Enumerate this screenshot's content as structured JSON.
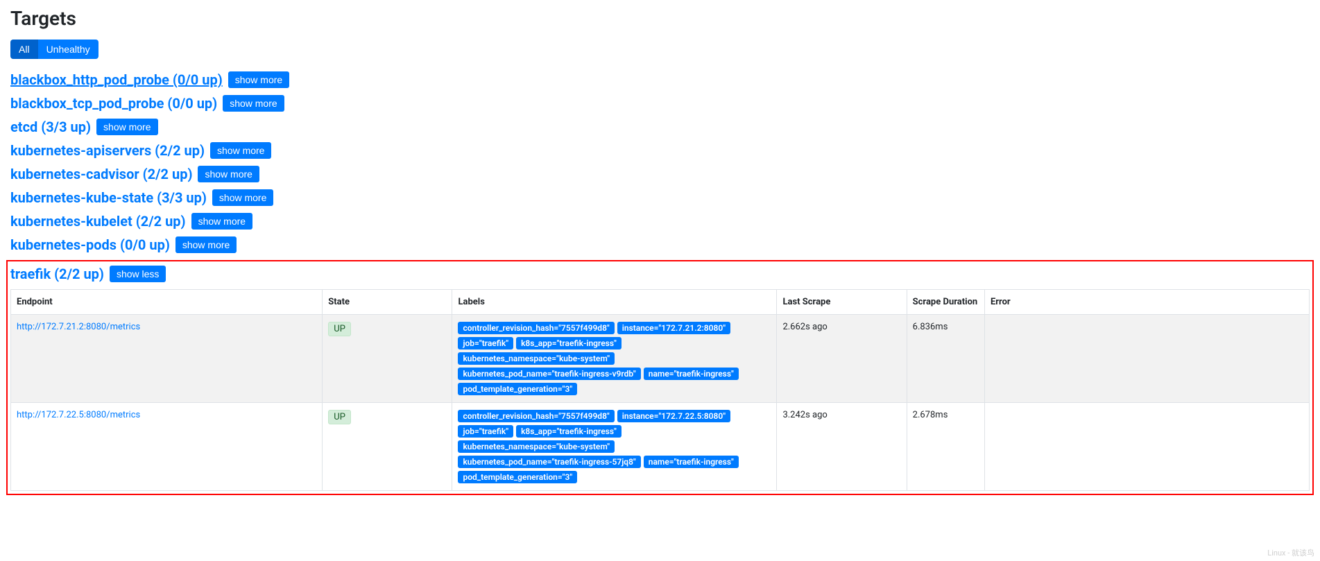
{
  "title": "Targets",
  "filter": {
    "all": "All",
    "unhealthy": "Unhealthy"
  },
  "show_more": "show more",
  "show_less": "show less",
  "targets": [
    {
      "name": "blackbox_http_pod_probe (0/0 up)",
      "underlined": true
    },
    {
      "name": "blackbox_tcp_pod_probe (0/0 up)"
    },
    {
      "name": "etcd (3/3 up)"
    },
    {
      "name": "kubernetes-apiservers (2/2 up)"
    },
    {
      "name": "kubernetes-cadvisor (2/2 up)"
    },
    {
      "name": "kubernetes-kube-state (3/3 up)"
    },
    {
      "name": "kubernetes-kubelet (2/2 up)"
    },
    {
      "name": "kubernetes-pods (0/0 up)"
    }
  ],
  "expanded": {
    "name": "traefik (2/2 up)",
    "columns": {
      "endpoint": "Endpoint",
      "state": "State",
      "labels": "Labels",
      "last_scrape": "Last Scrape",
      "scrape_duration": "Scrape Duration",
      "error": "Error"
    },
    "rows": [
      {
        "endpoint": "http://172.7.21.2:8080/metrics",
        "state": "UP",
        "labels": [
          "controller_revision_hash=\"7557f499d8\"",
          "instance=\"172.7.21.2:8080\"",
          "job=\"traefik\"",
          "k8s_app=\"traefik-ingress\"",
          "kubernetes_namespace=\"kube-system\"",
          "kubernetes_pod_name=\"traefik-ingress-v9rdb\"",
          "name=\"traefik-ingress\"",
          "pod_template_generation=\"3\""
        ],
        "last_scrape": "2.662s ago",
        "scrape_duration": "6.836ms",
        "error": ""
      },
      {
        "endpoint": "http://172.7.22.5:8080/metrics",
        "state": "UP",
        "labels": [
          "controller_revision_hash=\"7557f499d8\"",
          "instance=\"172.7.22.5:8080\"",
          "job=\"traefik\"",
          "k8s_app=\"traefik-ingress\"",
          "kubernetes_namespace=\"kube-system\"",
          "kubernetes_pod_name=\"traefik-ingress-57jq8\"",
          "name=\"traefik-ingress\"",
          "pod_template_generation=\"3\""
        ],
        "last_scrape": "3.242s ago",
        "scrape_duration": "2.678ms",
        "error": ""
      }
    ]
  },
  "watermark": "Linux - 就该鸟"
}
